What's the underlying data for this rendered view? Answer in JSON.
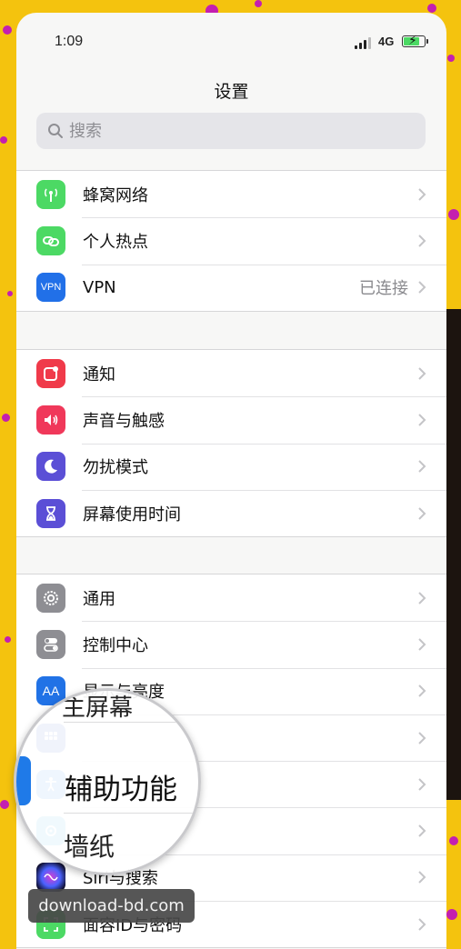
{
  "status_bar": {
    "time": "1:09",
    "network": "4G"
  },
  "nav": {
    "title": "设置"
  },
  "search": {
    "placeholder": "搜索"
  },
  "sections": [
    {
      "rows": [
        {
          "label": "蜂窝网络",
          "icon": "antenna-icon",
          "color": "#4cd964"
        },
        {
          "label": "个人热点",
          "icon": "hotspot-link-icon",
          "color": "#4cd964"
        },
        {
          "label": "VPN",
          "icon": "vpn-icon",
          "icon_text": "VPN",
          "color": "#2170e8",
          "detail": "已连接"
        }
      ]
    },
    {
      "rows": [
        {
          "label": "通知",
          "icon": "notifications-icon",
          "color": "#f03a4a"
        },
        {
          "label": "声音与触感",
          "icon": "speaker-icon",
          "color": "#f0385a"
        },
        {
          "label": "勿扰模式",
          "icon": "moon-icon",
          "color": "#5b4fd6"
        },
        {
          "label": "屏幕使用时间",
          "icon": "hourglass-icon",
          "color": "#5b4fd6"
        }
      ]
    },
    {
      "rows": [
        {
          "label": "通用",
          "icon": "gear-icon",
          "color": "#8e8e93"
        },
        {
          "label": "控制中心",
          "icon": "toggles-icon",
          "color": "#8e8e93"
        },
        {
          "label": "显示与亮度",
          "icon": "display-icon",
          "icon_text": "AA",
          "color": "#2172e6"
        },
        {
          "label": "",
          "icon": "home-screen-icon",
          "color": "#2a55c8"
        },
        {
          "label": "",
          "icon": "accessibility-icon",
          "color": "#1f7ae8"
        },
        {
          "label": "",
          "icon": "wallpaper-icon",
          "color": "#34aadc"
        },
        {
          "label": "Siri与搜索",
          "icon": "siri-icon",
          "color": "#1a1a3a"
        },
        {
          "label": "面容ID与密码",
          "icon": "face-id-icon",
          "color": "#4cd964"
        }
      ]
    }
  ],
  "magnifier": {
    "top_text": "主屏幕",
    "main_text": "辅助功能",
    "bottom_text": "墙纸"
  },
  "watermark": "download-bd.com",
  "colors": {
    "background": "#f4c30e",
    "dots": "#c41fb0"
  }
}
